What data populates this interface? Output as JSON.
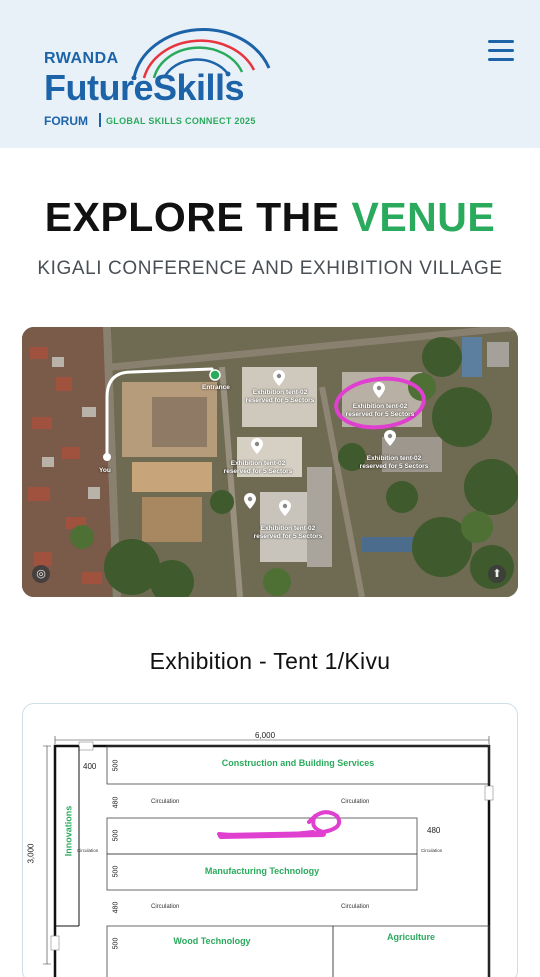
{
  "header": {
    "logo": {
      "line1": "RWANDA",
      "line2": "FutureSkills",
      "line3": "FORUM",
      "tagline": "GLOBAL SKILLS CONNECT 2025"
    },
    "menu_icon": "hamburger-menu-icon"
  },
  "hero": {
    "title_part1": "EXPLORE THE ",
    "title_part2": "VENUE",
    "subtitle": "KIGALI CONFERENCE AND EXHIBITION VILLAGE"
  },
  "map": {
    "labels": {
      "entrance": "Entrance",
      "you": "You",
      "tent_a": "Exhibition tent-02\nreserved for 5 Sectors",
      "tent_b": "Exhibition tent-02\nreserved for 5 Sectors",
      "tent_c": "Exhibition tent-02\nreserved for 5 Sectors",
      "tent_d": "Exhibition tent-02\nreserved for 5 Sectors",
      "tent_e": "Exhibition tent-02\nreserved for 5 Sectors"
    },
    "controls": {
      "left": "settings-icon",
      "right": "compass-icon"
    }
  },
  "section": {
    "heading": "Exhibition - Tent 1/Kivu"
  },
  "floor_plan": {
    "width_dim": "6,000",
    "height_dim": "3,000",
    "dim_400": "400",
    "dim_480": "480",
    "dim_500": "500",
    "circulation": "Circulation",
    "innovations": "Innovations",
    "construction": "Construction and Building Services",
    "manufacturing": "Manufacturing Technology",
    "wood": "Wood Technology",
    "agriculture": "Agriculture"
  },
  "colors": {
    "brand_blue": "#1c63a8",
    "brand_green": "#2aaa5c",
    "highlight_magenta": "#e040d0"
  }
}
